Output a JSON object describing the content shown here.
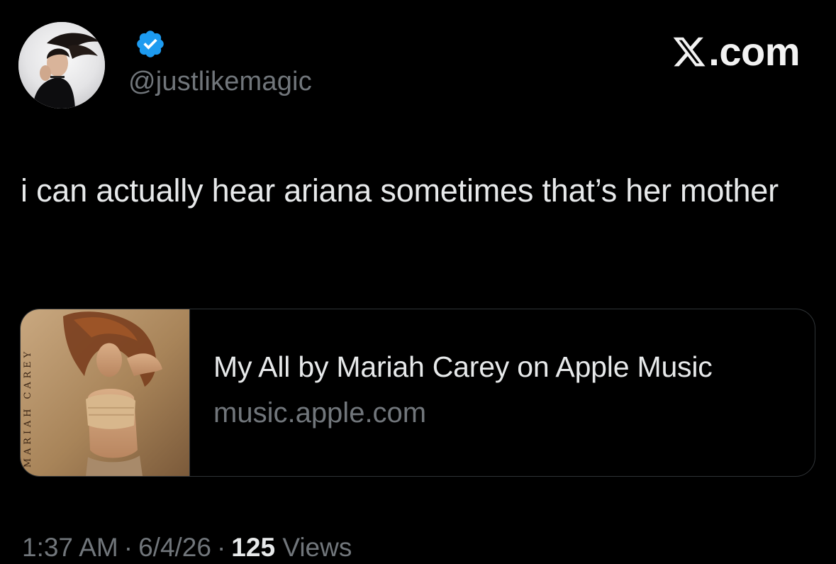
{
  "author": {
    "handle": "@justlikemagic",
    "avatar_icon": "profile-photo",
    "verified_icon": "verified-badge-icon",
    "verified_color": "#1d9bf0"
  },
  "brand": {
    "icon": "x-logo-icon",
    "domain_suffix": ".com"
  },
  "tweet": {
    "text": "i can actually hear ariana sometimes that’s her mother"
  },
  "link_card": {
    "title": "My All by Mariah Carey on Apple Music",
    "domain": "music.apple.com",
    "thumbnail_text": "MARIAH CAREY"
  },
  "meta": {
    "time": "1:37 AM",
    "separator": "·",
    "date": "6/4/26",
    "views_count": "125",
    "views_label": "Views"
  },
  "colors": {
    "background": "#000000",
    "primary_text": "#e7e9ea",
    "secondary_text": "#71767b",
    "border": "#2f3336"
  }
}
